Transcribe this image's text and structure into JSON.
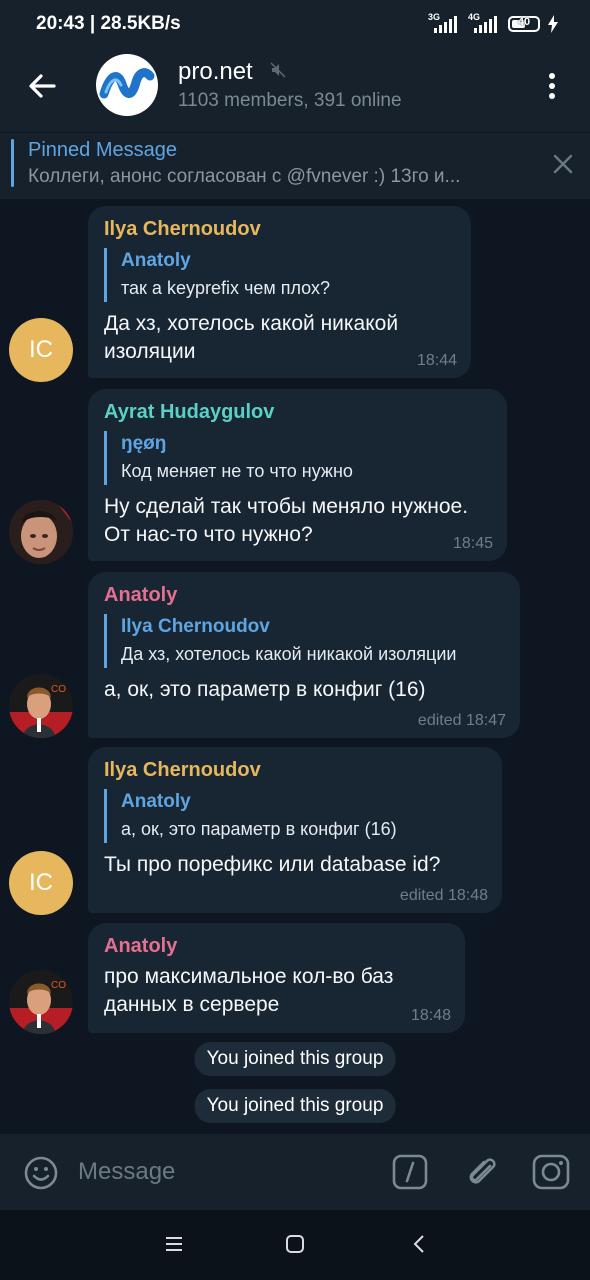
{
  "status_bar": {
    "time_speed": "20:43 | 28.5KB/s",
    "net1": "3G",
    "net2": "4G",
    "battery": "40"
  },
  "header": {
    "title": "pro.net",
    "subtitle": "1103 members, 391 online"
  },
  "pinned": {
    "title": "Pinned Message",
    "text": "Коллеги, анонс согласован с @fvnever :)  13го и..."
  },
  "messages": [
    {
      "sender": "Ilya Chernoudov",
      "sender_color": "#e7b75d",
      "avatar_initials": "IC",
      "reply_name": "Anatoly",
      "reply_text": "так а keyprefix чем плох?",
      "text": "Да хз, хотелось какой никакой изоляции",
      "time": "18:44"
    },
    {
      "sender": "Ayrat Hudaygulov",
      "sender_color": "#5bd0c4",
      "reply_name": "ŋęøŋ",
      "reply_text": "Код меняет не то что нужно",
      "text": "Ну сделай так чтобы меняло нужное. От нас-то что нужно?",
      "time": "18:45"
    },
    {
      "sender": "Anatoly",
      "sender_color": "#e4708f",
      "reply_name": "Ilya Chernoudov",
      "reply_text": "Да хз, хотелось какой никакой изоляции",
      "text": "а, ок, это параметр в конфиг (16)",
      "time": "edited 18:47"
    },
    {
      "sender": "Ilya Chernoudov",
      "sender_color": "#e7b75d",
      "avatar_initials": "IC",
      "reply_name": "Anatoly",
      "reply_text": "а, ок, это параметр в конфиг (16)",
      "text": "Ты про порефикс или database id?",
      "time": "edited 18:48"
    },
    {
      "sender": "Anatoly",
      "sender_color": "#e4708f",
      "text": "про максимальное кол-во баз данных в сервере",
      "time": "18:48"
    }
  ],
  "service": [
    "You joined this group",
    "You joined this group"
  ],
  "input": {
    "placeholder": "Message"
  },
  "icons": [
    "back-arrow-icon",
    "mute-icon",
    "more-vert-icon",
    "close-icon",
    "emoji-icon",
    "bot-command-icon",
    "attach-icon",
    "camera-icon",
    "nav-menu-icon",
    "nav-home-icon",
    "nav-back-icon"
  ]
}
